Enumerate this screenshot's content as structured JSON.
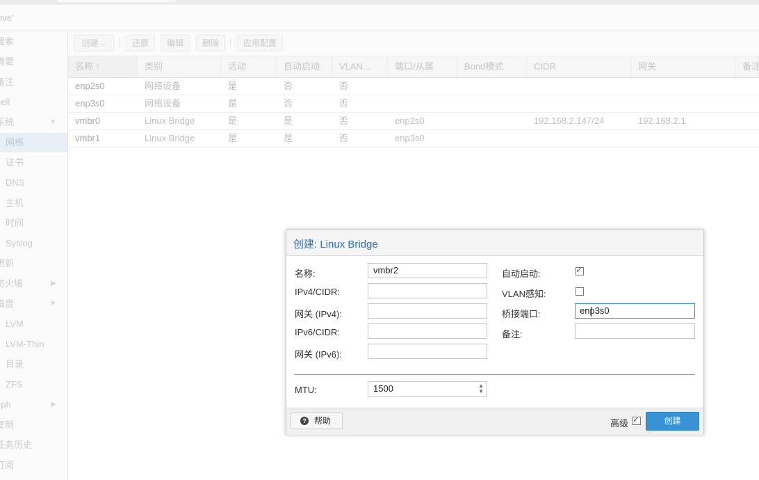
{
  "breadcrumb": {
    "node": "pve'"
  },
  "sidebar": {
    "items": [
      {
        "label": "搜索",
        "type": "top"
      },
      {
        "label": "摘要",
        "type": "top"
      },
      {
        "label": "备注",
        "type": "top"
      },
      {
        "label": "hell",
        "type": "top"
      },
      {
        "label": "系统",
        "type": "top",
        "arrow": "▼"
      },
      {
        "label": "网络",
        "type": "sub",
        "active": true
      },
      {
        "label": "证书",
        "type": "sub"
      },
      {
        "label": "DNS",
        "type": "sub"
      },
      {
        "label": "主机",
        "type": "sub"
      },
      {
        "label": "时间",
        "type": "sub"
      },
      {
        "label": "Syslog",
        "type": "sub"
      },
      {
        "label": "更新",
        "type": "top"
      },
      {
        "label": "防火墙",
        "type": "top",
        "arrow": "▶"
      },
      {
        "label": "磁盘",
        "type": "top",
        "arrow": "▼"
      },
      {
        "label": "LVM",
        "type": "sub"
      },
      {
        "label": "LVM-Thin",
        "type": "sub"
      },
      {
        "label": "目录",
        "type": "sub"
      },
      {
        "label": "ZFS",
        "type": "sub"
      },
      {
        "label": "eph",
        "type": "top",
        "arrow": "▶"
      },
      {
        "label": "复制",
        "type": "top"
      },
      {
        "label": "任务历史",
        "type": "top"
      },
      {
        "label": "订阅",
        "type": "top"
      }
    ]
  },
  "toolbar": {
    "create": "创建",
    "create_arrow": "⌵",
    "revert": "还原",
    "edit": "编辑",
    "delete": "删除",
    "apply": "应用配置"
  },
  "grid": {
    "columns": [
      "名称 ↑",
      "类别",
      "活动",
      "自动启动",
      "VLAN...",
      "端口/从属",
      "Bond模式",
      "CIDR",
      "网关",
      "备注"
    ],
    "rows": [
      [
        "enp2s0",
        "网络设备",
        "是",
        "否",
        "否",
        "",
        "",
        "",
        "",
        ""
      ],
      [
        "enp3s0",
        "网络设备",
        "是",
        "否",
        "否",
        "",
        "",
        "",
        "",
        ""
      ],
      [
        "vmbr0",
        "Linux Bridge",
        "是",
        "是",
        "否",
        "enp2s0",
        "",
        "192.168.2.147/24",
        "192.168.2.1",
        ""
      ],
      [
        "vmbr1",
        "Linux Bridge",
        "是",
        "是",
        "否",
        "enp3s0",
        "",
        "",
        "",
        ""
      ]
    ]
  },
  "dialog": {
    "title": "创建: Linux Bridge",
    "name_label": "名称:",
    "name_value": "vmbr2",
    "ipv4_label": "IPv4/CIDR:",
    "ipv4_value": "",
    "gw4_label": "网关 (IPv4):",
    "gw4_value": "",
    "ipv6_label": "IPv6/CIDR:",
    "ipv6_value": "",
    "gw6_label": "网关 (IPv6):",
    "gw6_value": "",
    "autostart_label": "自动启动:",
    "vlan_label": "VLAN感知:",
    "ports_label": "桥接端口:",
    "ports_value": "enp3s0",
    "comment_label": "备注:",
    "comment_value": "",
    "mtu_label": "MTU:",
    "mtu_value": "1500",
    "help": "帮助",
    "advanced": "高级",
    "create": "创建",
    "checkmark": "✓"
  }
}
